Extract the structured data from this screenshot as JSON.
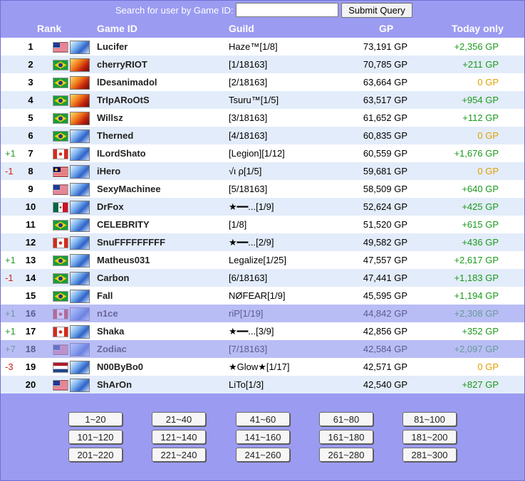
{
  "search": {
    "label": "Search for user by Game ID:",
    "value": "",
    "submit_label": "Submit Query"
  },
  "header": {
    "rank": "Rank",
    "game_id": "Game ID",
    "guild": "Guild",
    "gp": "GP",
    "today": "Today only"
  },
  "colors": {
    "header_bg": "#9b9bf2",
    "row_alt": "#e3ecfa",
    "positive": "#1a9a1a",
    "zero": "#e0a000",
    "up": "#2a9a2a",
    "down": "#cc2222"
  },
  "rows": [
    {
      "change": "",
      "rank": "1",
      "flag": "us",
      "emblem": "ice",
      "name": "Lucifer",
      "guild": "Haze™[1/8]",
      "gp": "73,191 GP",
      "today": "+2,356 GP",
      "faded": false
    },
    {
      "change": "",
      "rank": "2",
      "flag": "br",
      "emblem": "fire",
      "name": "cherryRIOT",
      "guild": "[1/18163]",
      "gp": "70,785 GP",
      "today": "+211 GP",
      "faded": false
    },
    {
      "change": "",
      "rank": "3",
      "flag": "br",
      "emblem": "fire",
      "name": "lDesanimadol",
      "guild": "[2/18163]",
      "gp": "63,664 GP",
      "today": "0 GP",
      "faded": false
    },
    {
      "change": "",
      "rank": "4",
      "flag": "br",
      "emblem": "fire",
      "name": "TrIpARoOtS",
      "guild": "Tsuru™[1/5]",
      "gp": "63,517 GP",
      "today": "+954 GP",
      "faded": false
    },
    {
      "change": "",
      "rank": "5",
      "flag": "br",
      "emblem": "fire",
      "name": "Willsz",
      "guild": "[3/18163]",
      "gp": "61,652 GP",
      "today": "+112 GP",
      "faded": false
    },
    {
      "change": "",
      "rank": "6",
      "flag": "br",
      "emblem": "ice",
      "name": "Therned",
      "guild": "[4/18163]",
      "gp": "60,835 GP",
      "today": "0 GP",
      "faded": false
    },
    {
      "change": "+1",
      "rank": "7",
      "flag": "ca",
      "emblem": "ice",
      "name": "ILordShato",
      "guild": "[Legion][1/12]",
      "gp": "60,559 GP",
      "today": "+1,676 GP",
      "faded": false
    },
    {
      "change": "-1",
      "rank": "8",
      "flag": "my",
      "emblem": "ice",
      "name": "iHero",
      "guild": "√ι ρ[1/5]",
      "gp": "59,681 GP",
      "today": "0 GP",
      "faded": false
    },
    {
      "change": "",
      "rank": "9",
      "flag": "us",
      "emblem": "ice",
      "name": "SexyMachinee",
      "guild": "[5/18163]",
      "gp": "58,509 GP",
      "today": "+640 GP",
      "faded": false
    },
    {
      "change": "",
      "rank": "10",
      "flag": "mx",
      "emblem": "ice",
      "name": "DrFox",
      "guild": "★━━...[1/9]",
      "gp": "52,624 GP",
      "today": "+425 GP",
      "faded": false
    },
    {
      "change": "",
      "rank": "11",
      "flag": "br",
      "emblem": "ice",
      "name": "CELEBRITY",
      "guild": "[1/8]",
      "gp": "51,520 GP",
      "today": "+615 GP",
      "faded": false
    },
    {
      "change": "",
      "rank": "12",
      "flag": "ca",
      "emblem": "ice",
      "name": "SnuFFFFFFFFF",
      "guild": "★━━...[2/9]",
      "gp": "49,582 GP",
      "today": "+436 GP",
      "faded": false
    },
    {
      "change": "+1",
      "rank": "13",
      "flag": "br",
      "emblem": "ice",
      "name": "Matheus031",
      "guild": "Legalize[1/25]",
      "gp": "47,557 GP",
      "today": "+2,617 GP",
      "faded": false
    },
    {
      "change": "-1",
      "rank": "14",
      "flag": "br",
      "emblem": "ice",
      "name": "Carbon",
      "guild": "[6/18163]",
      "gp": "47,441 GP",
      "today": "+1,183 GP",
      "faded": false
    },
    {
      "change": "",
      "rank": "15",
      "flag": "br",
      "emblem": "ice",
      "name": "Fall",
      "guild": "NØFEAR[1/9]",
      "gp": "45,595 GP",
      "today": "+1,194 GP",
      "faded": false
    },
    {
      "change": "+1",
      "rank": "16",
      "flag": "ca",
      "emblem": "ice",
      "name": "n1ce",
      "guild": "riP[1/19]",
      "gp": "44,842 GP",
      "today": "+2,308 GP",
      "faded": true
    },
    {
      "change": "+1",
      "rank": "17",
      "flag": "ca",
      "emblem": "ice",
      "name": "Shaka",
      "guild": "★━━...[3/9]",
      "gp": "42,856 GP",
      "today": "+352 GP",
      "faded": false
    },
    {
      "change": "+7",
      "rank": "18",
      "flag": "us",
      "emblem": "ice",
      "name": "Zodiac",
      "guild": "[7/18163]",
      "gp": "42,584 GP",
      "today": "+2,097 GP",
      "faded": true
    },
    {
      "change": "-3",
      "rank": "19",
      "flag": "nl",
      "emblem": "ice",
      "name": "N00ByBo0",
      "guild": "★Glow★[1/17]",
      "gp": "42,571 GP",
      "today": "0 GP",
      "faded": false
    },
    {
      "change": "",
      "rank": "20",
      "flag": "us",
      "emblem": "ice",
      "name": "ShArOn",
      "guild": "LiTo[1/3]",
      "gp": "42,540 GP",
      "today": "+827 GP",
      "faded": false
    }
  ],
  "pages": [
    "1~20",
    "21~40",
    "41~60",
    "61~80",
    "81~100",
    "101~120",
    "121~140",
    "141~160",
    "161~180",
    "181~200",
    "201~220",
    "221~240",
    "241~260",
    "261~280",
    "281~300"
  ]
}
